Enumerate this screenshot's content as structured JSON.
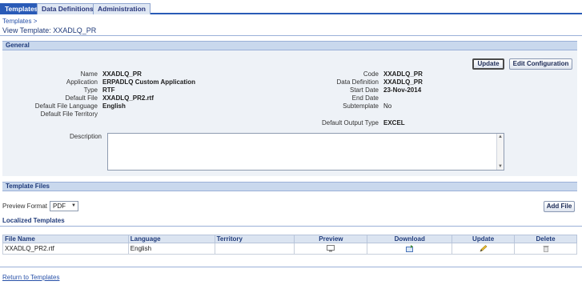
{
  "tabs": [
    {
      "label": "Templates",
      "active": true
    },
    {
      "label": "Data Definitions",
      "active": false
    },
    {
      "label": "Administration",
      "active": false
    }
  ],
  "breadcrumb": {
    "link": "Templates",
    "separator": ">"
  },
  "page_title": "View Template: XXADLQ_PR",
  "general": {
    "header": "General",
    "update_label": "Update",
    "edit_config_label": "Edit Configuration",
    "left_fields": [
      {
        "label": "Name",
        "value": "XXADLQ_PR"
      },
      {
        "label": "Application",
        "value": "ERPADLQ Custom Application"
      },
      {
        "label": "Type",
        "value": "RTF"
      },
      {
        "label": "Default File",
        "value": "XXADLQ_PR2.rtf"
      },
      {
        "label": "Default File Language",
        "value": "English"
      },
      {
        "label": "Default File Territory",
        "value": ""
      }
    ],
    "right_fields": [
      {
        "label": "Code",
        "value": "XXADLQ_PR"
      },
      {
        "label": "Data Definition",
        "value": "XXADLQ_PR"
      },
      {
        "label": "Start Date",
        "value": "23-Nov-2014"
      },
      {
        "label": "End Date",
        "value": ""
      },
      {
        "label": "Subtemplate",
        "value": "No"
      }
    ],
    "default_output_type_label": "Default Output Type",
    "default_output_type_value": "EXCEL",
    "description_label": "Description",
    "description_value": ""
  },
  "template_files": {
    "header": "Template Files",
    "preview_format_label": "Preview Format",
    "preview_format_value": "PDF",
    "add_file_label": "Add File",
    "localized_title": "Localized Templates",
    "columns": [
      "File Name",
      "Language",
      "Territory",
      "Preview",
      "Download",
      "Update",
      "Delete"
    ],
    "rows": [
      {
        "file_name": "XXADLQ_PR2.rtf",
        "language": "English",
        "territory": ""
      }
    ]
  },
  "return_link": "Return to Templates",
  "icons": {
    "preview": "preview-icon",
    "download": "download-icon",
    "update": "pencil-icon",
    "delete": "trash-icon"
  },
  "colors": {
    "tab_active": "#2a5bb7",
    "section_header": "#c9d8ed",
    "section_body": "#eef2f7",
    "link": "#2750a8"
  }
}
